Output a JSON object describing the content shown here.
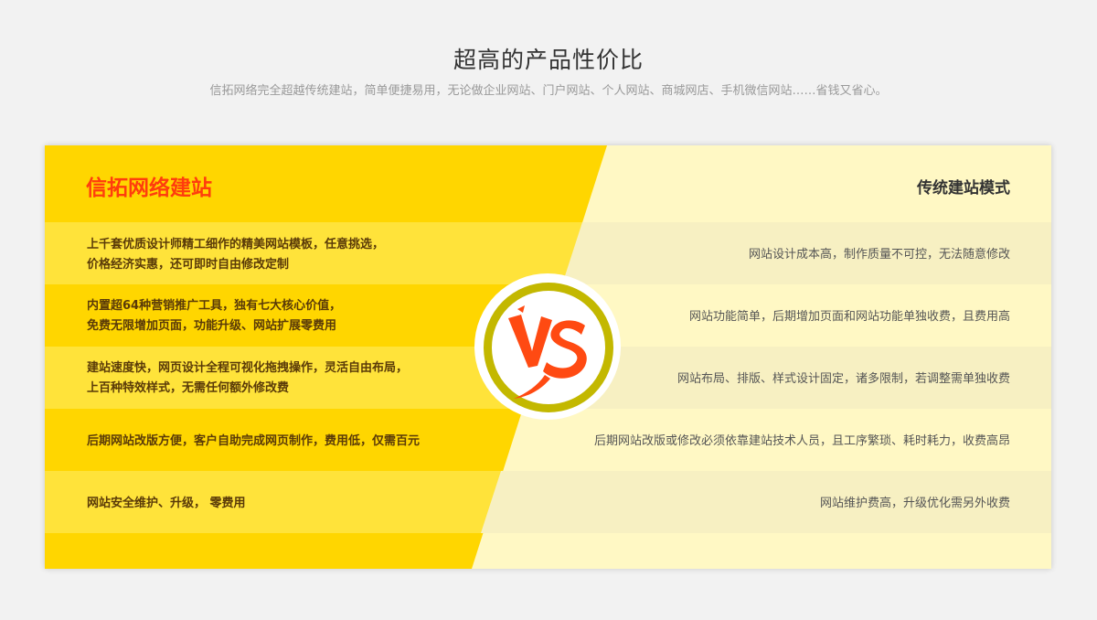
{
  "header": {
    "title": "超高的产品性价比",
    "subtitle": "信拓网络完全超越传统建站，简单便捷易用，无论做企业网站、门户网站、个人网站、商城网店、手机微信网站……省钱又省心。"
  },
  "comparison": {
    "left_title": "信拓网络建站",
    "right_title": "传统建站模式",
    "vs_text": "VS",
    "rows": [
      {
        "left": [
          "上千套优质设计师精工细作的精美网站模板，任意挑选，",
          "价格经济实惠，还可即时自由修改定制"
        ],
        "right": "网站设计成本高，制作质量不可控，无法随意修改"
      },
      {
        "left": [
          "内置超64种营销推广工具，独有七大核心价值，",
          "免费无限增加页面，功能升级、网站扩展零费用"
        ],
        "right": "网站功能简单，后期增加页面和网站功能单独收费，且费用高"
      },
      {
        "left": [
          "建站速度快，网页设计全程可视化拖拽操作，灵活自由布局，",
          "上百种特效样式，无需任何额外修改费"
        ],
        "right": "网站布局、排版、样式设计固定，诸多限制，若调整需单独收费"
      },
      {
        "left": [
          "后期网站改版方便，客户自助完成网页制作，费用低，仅需百元"
        ],
        "right": "后期网站改版或修改必须依靠建站技术人员，且工序繁琐、耗时耗力，收费高昂"
      },
      {
        "left": [
          "网站安全维护、升级， 零费用"
        ],
        "right": "网站维护费高，升级优化需另外收费"
      }
    ]
  },
  "colors": {
    "accent_left": "#ffd600",
    "accent_right": "#fff8c4",
    "left_title": "#ff3d0d",
    "vs_ring": "#c3b800",
    "vs_glyph": "#ff4a12"
  }
}
